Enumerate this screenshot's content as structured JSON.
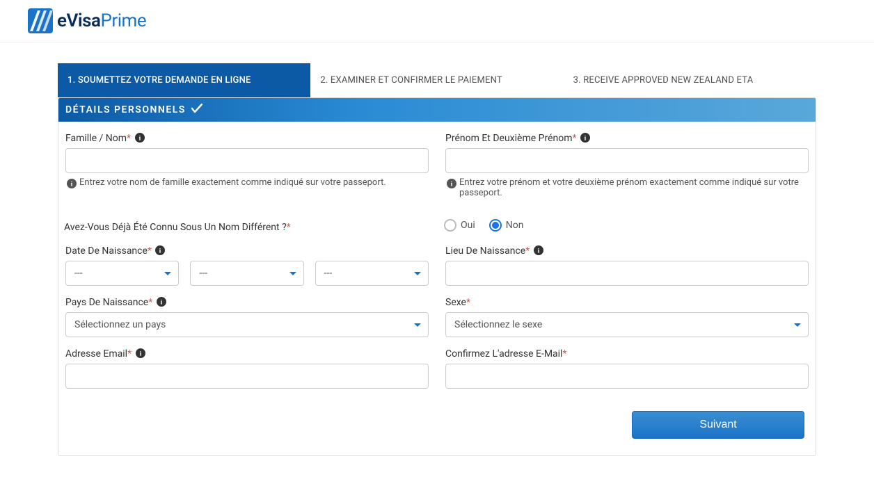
{
  "brand": {
    "name_e": "e",
    "name_visa": "Visa",
    "name_prime": "Prime"
  },
  "steps": {
    "s1": "1. SOUMETTEZ VOTRE DEMANDE EN LIGNE",
    "s2": "2. EXAMINER ET CONFIRMER LE PAIEMENT",
    "s3": "3. RECEIVE APPROVED NEW ZEALAND ETA"
  },
  "panel": {
    "title": "DÉTAILS PERSONNELS"
  },
  "labels": {
    "family_name": "Famille / Nom",
    "given_names": "Prénom Et Deuxième Prénom",
    "known_by_other": "Avez-Vous Déjà Été Connu Sous Un Nom Différent ?",
    "dob": "Date De Naissance",
    "pob": "Lieu De Naissance",
    "cob": "Pays De Naissance",
    "sex": "Sexe",
    "email": "Adresse Email",
    "email_confirm": "Confirmez L'adresse E-Mail"
  },
  "helpers": {
    "family_name": "Entrez votre nom de famille exactement comme indiqué sur votre passeport.",
    "given_names": "Entrez votre prénom et votre deuxième prénom exactement comme indiqué sur votre passeport."
  },
  "options": {
    "oui": "Oui",
    "non": "Non",
    "dash": "---",
    "select_country": "Sélectionnez un pays",
    "select_sex": "Sélectionnez le sexe"
  },
  "values": {
    "family_name": "",
    "given_names": "",
    "known_by_other": "Non",
    "dob_day": "---",
    "dob_month": "---",
    "dob_year": "---",
    "pob": "",
    "cob": "Sélectionnez un pays",
    "sex": "Sélectionnez le sexe",
    "email": "",
    "email_confirm": ""
  },
  "buttons": {
    "next": "Suivant"
  }
}
